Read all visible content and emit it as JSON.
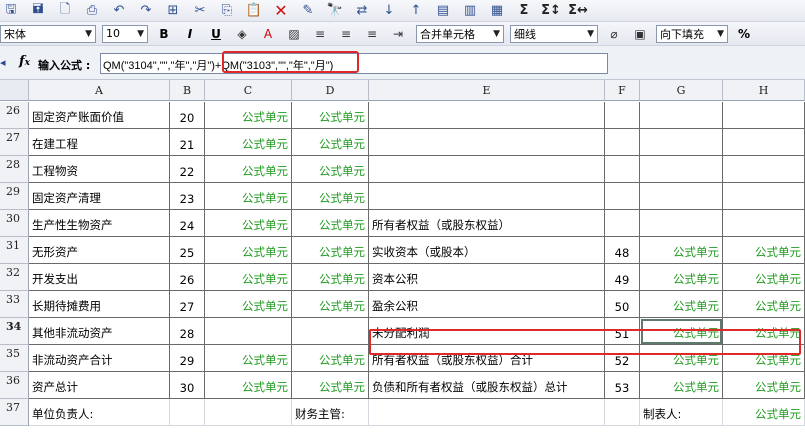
{
  "toolbar1": {
    "buttons": [
      {
        "name": "save-icon",
        "glyph": "🖫"
      },
      {
        "name": "saveas-icon",
        "glyph": "🖬"
      },
      {
        "name": "print-preview-icon",
        "glyph": "🗋"
      },
      {
        "name": "print-icon",
        "glyph": "⎙"
      },
      {
        "name": "undo-icon",
        "glyph": "↶"
      },
      {
        "name": "redo-icon",
        "glyph": "↷"
      },
      {
        "name": "select-all-icon",
        "glyph": "⊞"
      },
      {
        "name": "cut-icon",
        "glyph": "✂"
      },
      {
        "name": "copy-icon",
        "glyph": "⎘"
      },
      {
        "name": "paste-icon",
        "glyph": "📋"
      },
      {
        "name": "delete-icon",
        "glyph": "✕"
      },
      {
        "name": "format-painter-icon",
        "glyph": "✎"
      },
      {
        "name": "find-icon",
        "glyph": "🔭"
      },
      {
        "name": "replace-icon",
        "glyph": "⇄"
      },
      {
        "name": "sort-asc-icon",
        "glyph": "↓"
      },
      {
        "name": "sort-desc-icon",
        "glyph": "↑"
      },
      {
        "name": "insert-row-icon",
        "glyph": "▤"
      },
      {
        "name": "insert-col-icon",
        "glyph": "▥"
      },
      {
        "name": "delete-row-icon",
        "glyph": "▦"
      },
      {
        "name": "sum-icon",
        "glyph": "Σ"
      },
      {
        "name": "sum-row-icon",
        "glyph": "Σ↕"
      },
      {
        "name": "sum-col-icon",
        "glyph": "Σ↔"
      }
    ]
  },
  "toolbar2": {
    "font_name": "宋体",
    "font_size": "10",
    "bold": "B",
    "italic": "I",
    "underline": "U",
    "merge": "合并单元格",
    "border": "细线",
    "fill": "向下填充",
    "percent": "%"
  },
  "formula_bar": {
    "label": "输入公式 :",
    "value": "QM(\"3104\",\"\",\"年\",\"月\")+QM(\"3103\",\"\",\"年\",\"月\")"
  },
  "columns": [
    "A",
    "B",
    "C",
    "D",
    "E",
    "F",
    "G",
    "H"
  ],
  "rows": [
    {
      "num": "26",
      "a": "固定资产账面价值",
      "b": "20",
      "c": "公式单元",
      "d": "公式单元",
      "e": "",
      "f": "",
      "g": "",
      "h": ""
    },
    {
      "num": "27",
      "a": "在建工程",
      "b": "21",
      "c": "公式单元",
      "d": "公式单元",
      "e": "",
      "f": "",
      "g": "",
      "h": ""
    },
    {
      "num": "28",
      "a": "工程物资",
      "b": "22",
      "c": "公式单元",
      "d": "公式单元",
      "e": "",
      "f": "",
      "g": "",
      "h": ""
    },
    {
      "num": "29",
      "a": "固定资产清理",
      "b": "23",
      "c": "公式单元",
      "d": "公式单元",
      "e": "",
      "f": "",
      "g": "",
      "h": ""
    },
    {
      "num": "30",
      "a": "生产性生物资产",
      "b": "24",
      "c": "公式单元",
      "d": "公式单元",
      "e": "所有者权益（或股东权益）",
      "f": "",
      "g": "",
      "h": ""
    },
    {
      "num": "31",
      "a": "无形资产",
      "b": "25",
      "c": "公式单元",
      "d": "公式单元",
      "e": "实收资本（或股本）",
      "f": "48",
      "g": "公式单元",
      "h": "公式单元"
    },
    {
      "num": "32",
      "a": "开发支出",
      "b": "26",
      "c": "公式单元",
      "d": "公式单元",
      "e": "资本公积",
      "f": "49",
      "g": "公式单元",
      "h": "公式单元"
    },
    {
      "num": "33",
      "a": "长期待摊费用",
      "b": "27",
      "c": "公式单元",
      "d": "公式单元",
      "e": "盈余公积",
      "f": "50",
      "g": "公式单元",
      "h": "公式单元"
    },
    {
      "num": "34",
      "a": "其他非流动资产",
      "b": "28",
      "c": "",
      "d": "",
      "e": "未分配利润",
      "f": "51",
      "g": "公式单元",
      "h": "公式单元"
    },
    {
      "num": "35",
      "a": "非流动资产合计",
      "b": "29",
      "c": "公式单元",
      "d": "公式单元",
      "e": "所有者权益（或股东权益）合计",
      "f": "52",
      "g": "公式单元",
      "h": "公式单元"
    },
    {
      "num": "36",
      "a": "资产总计",
      "b": "30",
      "c": "公式单元",
      "d": "公式单元",
      "e": "负债和所有者权益（或股东权益）总计",
      "f": "53",
      "g": "公式单元",
      "h": "公式单元"
    },
    {
      "num": "37",
      "a": "单位负责人:",
      "b": "",
      "c": "",
      "d": "财务主管:",
      "e": "",
      "f": "",
      "g": "制表人:",
      "h": "公式单元"
    }
  ],
  "colors": {
    "formula_green": "#1f9a1f",
    "highlight_red": "#e02828"
  }
}
